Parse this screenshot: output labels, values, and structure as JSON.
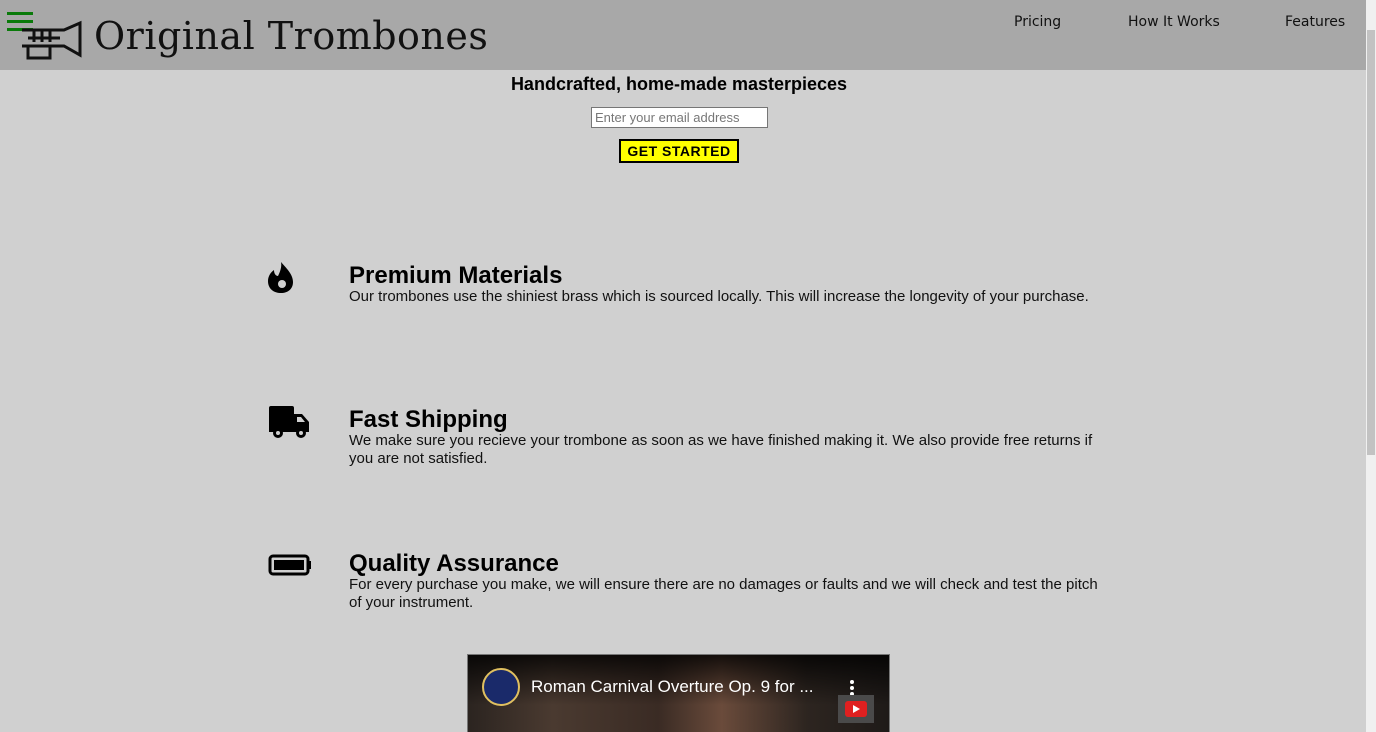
{
  "header": {
    "brand": "Original Trombones",
    "nav": [
      {
        "label": "Pricing"
      },
      {
        "label": "How It Works"
      },
      {
        "label": "Features"
      }
    ]
  },
  "hero": {
    "title": "Handcrafted, home-made masterpieces",
    "email_placeholder": "Enter your email address",
    "email_value": "",
    "cta_label": "GET STARTED"
  },
  "features": [
    {
      "icon": "fire-icon",
      "title": "Premium Materials",
      "text": "Our trombones use the shiniest brass which is sourced locally. This will increase the longevity of your purchase."
    },
    {
      "icon": "truck-icon",
      "title": "Fast Shipping",
      "text": "We make sure you recieve your trombone as soon as we have finished making it. We also provide free returns if you are not satisfied."
    },
    {
      "icon": "battery-icon",
      "title": "Quality Assurance",
      "text": "For every purchase you make, we will ensure there are no damages or faults and we will check and test the pitch of your instrument."
    }
  ],
  "video": {
    "title": "Roman Carnival Overture Op. 9 for ..."
  },
  "colors": {
    "header_bg": "#a8a8a8",
    "page_bg": "#d0d0d0",
    "cta_bg": "#ffff00",
    "menu_icon": "#0a7a0a"
  }
}
